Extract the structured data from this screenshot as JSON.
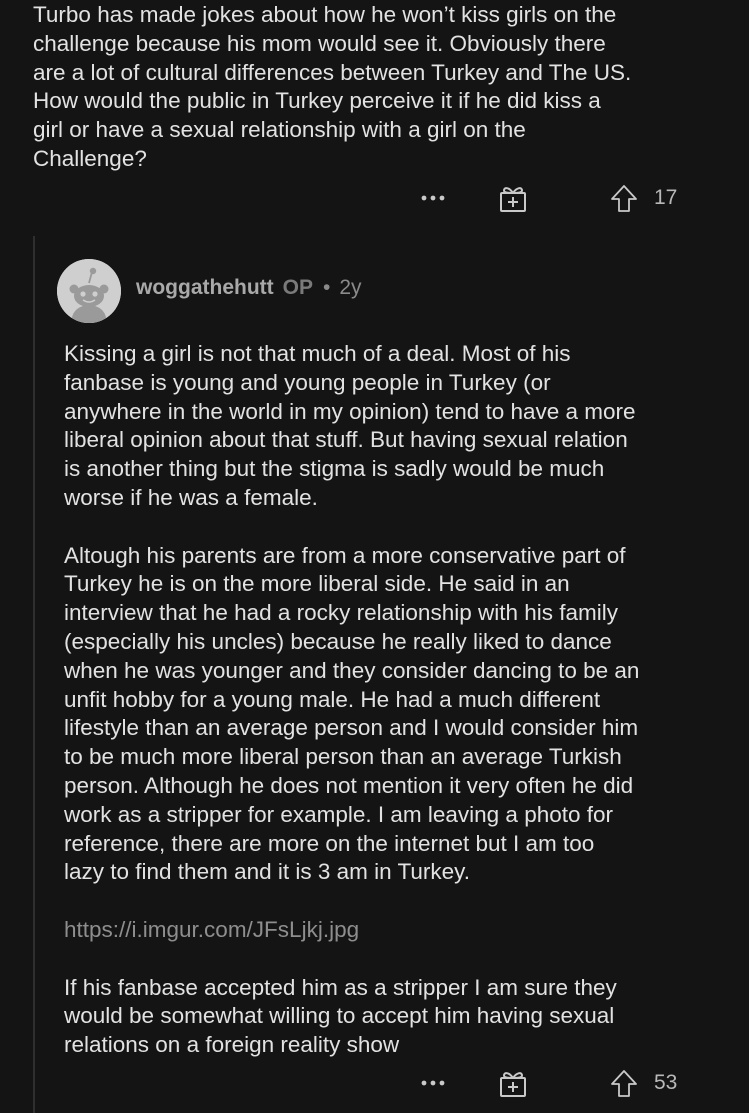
{
  "parent_comment": {
    "lines": [
      "Turbo has made jokes about how he won’t kiss girls on the",
      "challenge because his mom would see it. Obviously there",
      "are a lot of cultural differences between Turkey and The US.",
      "How would the public in Turkey perceive it if he did kiss a",
      "girl or have a sexual relationship with a girl on the",
      "Challenge?"
    ],
    "upvotes": "17"
  },
  "reply": {
    "username": "woggathehutt",
    "op_tag": "OP",
    "separator": "•",
    "age": "2y",
    "paragraph1_lines": [
      "Kissing a girl is not that much of a deal. Most of his",
      "fanbase is young and young people in Turkey (or",
      "anywhere in the world in my opinion) tend to have a more",
      "liberal opinion about that stuff. But having sexual relation",
      "is another thing but the stigma is sadly would be much",
      "worse if he was a female."
    ],
    "paragraph2_lines": [
      "Altough his parents are from a more conservative part of",
      "Turkey he is on the more liberal side. He said in an",
      "interview that he had a rocky relationship with his family",
      "(especially his uncles) because he really liked to dance",
      "when he was younger and they consider dancing to be an",
      "unfit hobby for a young male. He had a much different",
      "lifestyle than an average person and I would consider him",
      "to be much more liberal person than an average Turkish",
      "person. Although he does not mention it very often he did",
      "work as a stripper for example. I am leaving a photo for",
      "reference, there are more on the internet but I am too",
      "lazy to find them and it is 3 am in Turkey."
    ],
    "link": "https://i.imgur.com/JFsLjkj.jpg",
    "paragraph3_lines": [
      "If his fanbase accepted him as a stripper I am sure they",
      "would be somewhat willing to accept him having sexual",
      "relations on a foreign reality show"
    ],
    "upvotes": "53"
  },
  "icons": {
    "more": "more-options-icon",
    "award": "award-gift-icon",
    "upvote": "upvote-arrow-icon",
    "avatar": "snoo-avatar-icon"
  },
  "colors": {
    "background": "#141414",
    "text": "#e2e2e2",
    "muted": "#8a8a8a",
    "thread_line": "#2f2f2f"
  }
}
